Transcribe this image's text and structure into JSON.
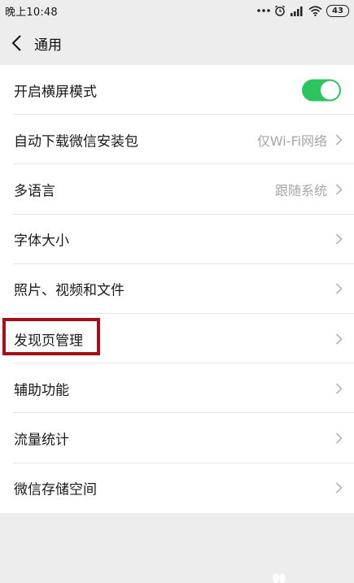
{
  "status_bar": {
    "time": "晚上10:48",
    "battery": "43"
  },
  "nav": {
    "title": "通用"
  },
  "settings": [
    {
      "label": "开启横屏模式",
      "value": "",
      "control": "toggle",
      "toggle_on": true
    },
    {
      "label": "自动下载微信安装包",
      "value": "仅Wi-Fi网络",
      "control": "chevron"
    },
    {
      "label": "多语言",
      "value": "跟随系统",
      "control": "chevron"
    },
    {
      "label": "字体大小",
      "value": "",
      "control": "chevron"
    },
    {
      "label": "照片、视频和文件",
      "value": "",
      "control": "chevron"
    },
    {
      "label": "发现页管理",
      "value": "",
      "control": "chevron",
      "highlighted": true
    },
    {
      "label": "辅助功能",
      "value": "",
      "control": "chevron"
    },
    {
      "label": "流量统计",
      "value": "",
      "control": "chevron"
    },
    {
      "label": "微信存储空间",
      "value": "",
      "control": "chevron"
    }
  ],
  "colors": {
    "background": "#ededed",
    "toggle_on": "#2dc35f",
    "highlight": "#a2111a",
    "secondary_text": "#a6a6a6"
  },
  "icons": {
    "back": "chevron-left-icon",
    "row": "chevron-right-icon",
    "alarm": "alarm-icon",
    "signal": "signal-icon",
    "wifi": "wifi-icon"
  }
}
